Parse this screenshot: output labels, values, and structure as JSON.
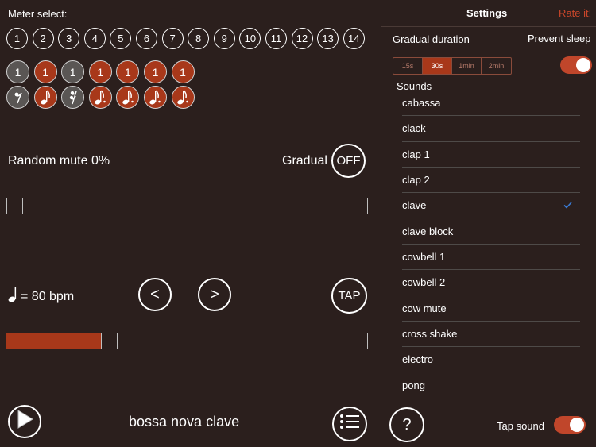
{
  "meter": {
    "title": "Meter select:",
    "numbers": [
      "1",
      "2",
      "3",
      "4",
      "5",
      "6",
      "7",
      "8",
      "9",
      "10",
      "11",
      "12",
      "13",
      "14"
    ]
  },
  "beats": {
    "top": [
      {
        "label": "1",
        "style": "gray"
      },
      {
        "label": "1",
        "style": "red"
      },
      {
        "label": "1",
        "style": "gray"
      },
      {
        "label": "1",
        "style": "red"
      },
      {
        "label": "1",
        "style": "red"
      },
      {
        "label": "1",
        "style": "red"
      },
      {
        "label": "1",
        "style": "red"
      }
    ],
    "bottom": [
      {
        "icon": "eighth-rest-icon",
        "style": "gray"
      },
      {
        "icon": "eighth-note-icon",
        "style": "red"
      },
      {
        "icon": "sixteenth-rest-icon",
        "style": "gray"
      },
      {
        "icon": "dotted-eighth-note-icon",
        "style": "red"
      },
      {
        "icon": "dotted-eighth-note-icon",
        "style": "red"
      },
      {
        "icon": "dotted-eighth-note-icon",
        "style": "red"
      },
      {
        "icon": "dotted-eighth-note-icon",
        "style": "red"
      }
    ]
  },
  "random_mute": {
    "label": "Random mute 0%",
    "value": 0,
    "gradual_label": "Gradual",
    "gradual_state": "OFF"
  },
  "tempo": {
    "note_icon": "quarter-note-icon",
    "label": "= 80 bpm",
    "bpm": 80,
    "prev": "<",
    "next": ">",
    "tap": "TAP",
    "slider_fraction": 0.25
  },
  "transport": {
    "play_icon": "play-icon",
    "rhythm_name": "bossa nova clave",
    "menu_icon": "list-icon"
  },
  "settings": {
    "title": "Settings",
    "rate": "Rate it!",
    "gradual_duration_label": "Gradual duration",
    "durations": [
      "15s",
      "30s",
      "1min",
      "2min"
    ],
    "selected_duration": "30s",
    "prevent_sleep_label": "Prevent sleep",
    "prevent_sleep_on": true,
    "sounds_label": "Sounds",
    "sounds": [
      "cabassa",
      "clack",
      "clap 1",
      "clap 2",
      "clave",
      "clave block",
      "cowbell 1",
      "cowbell 2",
      "cow mute",
      "cross shake",
      "electro",
      "pong"
    ],
    "selected_sound": "clave",
    "help": "?",
    "tap_sound_label": "Tap sound",
    "tap_sound_on": true
  },
  "colors": {
    "background": "#2b1f1d",
    "accent": "#a8381a",
    "link": "#c9462a",
    "check": "#3a7bd5"
  }
}
